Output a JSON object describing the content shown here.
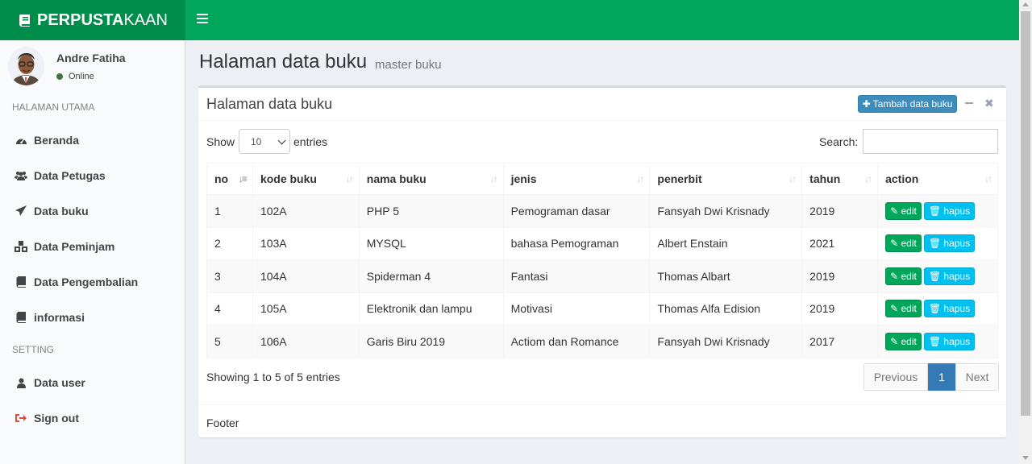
{
  "app": {
    "logo_bold": "PERPUSTA",
    "logo_light": "KAAN"
  },
  "colors": {
    "header": "#00a65a",
    "logo_bg": "#008d4c",
    "primary": "#3c8dbc",
    "info": "#00c0ef"
  },
  "user": {
    "name": "Andre Fatiha",
    "status": "Online"
  },
  "sidebar": {
    "header_main": "HALAMAN UTAMA",
    "items": [
      {
        "label": "Beranda",
        "icon": "dashboard-icon"
      },
      {
        "label": "Data Petugas",
        "icon": "users-icon"
      },
      {
        "label": "Data buku",
        "icon": "send-icon"
      },
      {
        "label": "Data Peminjam",
        "icon": "cubes-icon"
      },
      {
        "label": "Data Pengembalian",
        "icon": "book-icon"
      },
      {
        "label": "informasi",
        "icon": "book-icon"
      }
    ],
    "header_setting": "SETTING",
    "setting_items": [
      {
        "label": "Data user",
        "icon": "user-icon"
      },
      {
        "label": "Sign out",
        "icon": "sign-out-icon"
      }
    ]
  },
  "page": {
    "title": "Halaman data buku",
    "subtitle": "master buku"
  },
  "box": {
    "title": "Halaman data buku",
    "add_button": "Tambah data buku",
    "footer": "Footer"
  },
  "table_controls": {
    "show_label": "Show",
    "page_size": "10",
    "entries_label": "entries",
    "search_label": "Search:",
    "info": "Showing 1 to 5 of 5 entries",
    "prev": "Previous",
    "current_page": "1",
    "next": "Next"
  },
  "table": {
    "columns": [
      "no",
      "kode buku",
      "nama buku",
      "jenis",
      "penerbit",
      "tahun",
      "action"
    ],
    "edit_label": "edit",
    "delete_label": "hapus",
    "rows": [
      [
        "1",
        "102A",
        "PHP 5",
        "Pemograman dasar",
        "Fansyah Dwi Krisnady",
        "2019"
      ],
      [
        "2",
        "103A",
        "MYSQL",
        "bahasa Pemograman",
        "Albert Enstain",
        "2021"
      ],
      [
        "3",
        "104A",
        "Spiderman 4",
        "Fantasi",
        "Thomas Albart",
        "2019"
      ],
      [
        "4",
        "105A",
        "Elektronik dan lampu",
        "Motivasi",
        "Thomas Alfa Edision",
        "2019"
      ],
      [
        "5",
        "106A",
        "Garis Biru 2019",
        "Actiom dan Romance",
        "Fansyah Dwi Krisnady",
        "2017"
      ]
    ]
  }
}
